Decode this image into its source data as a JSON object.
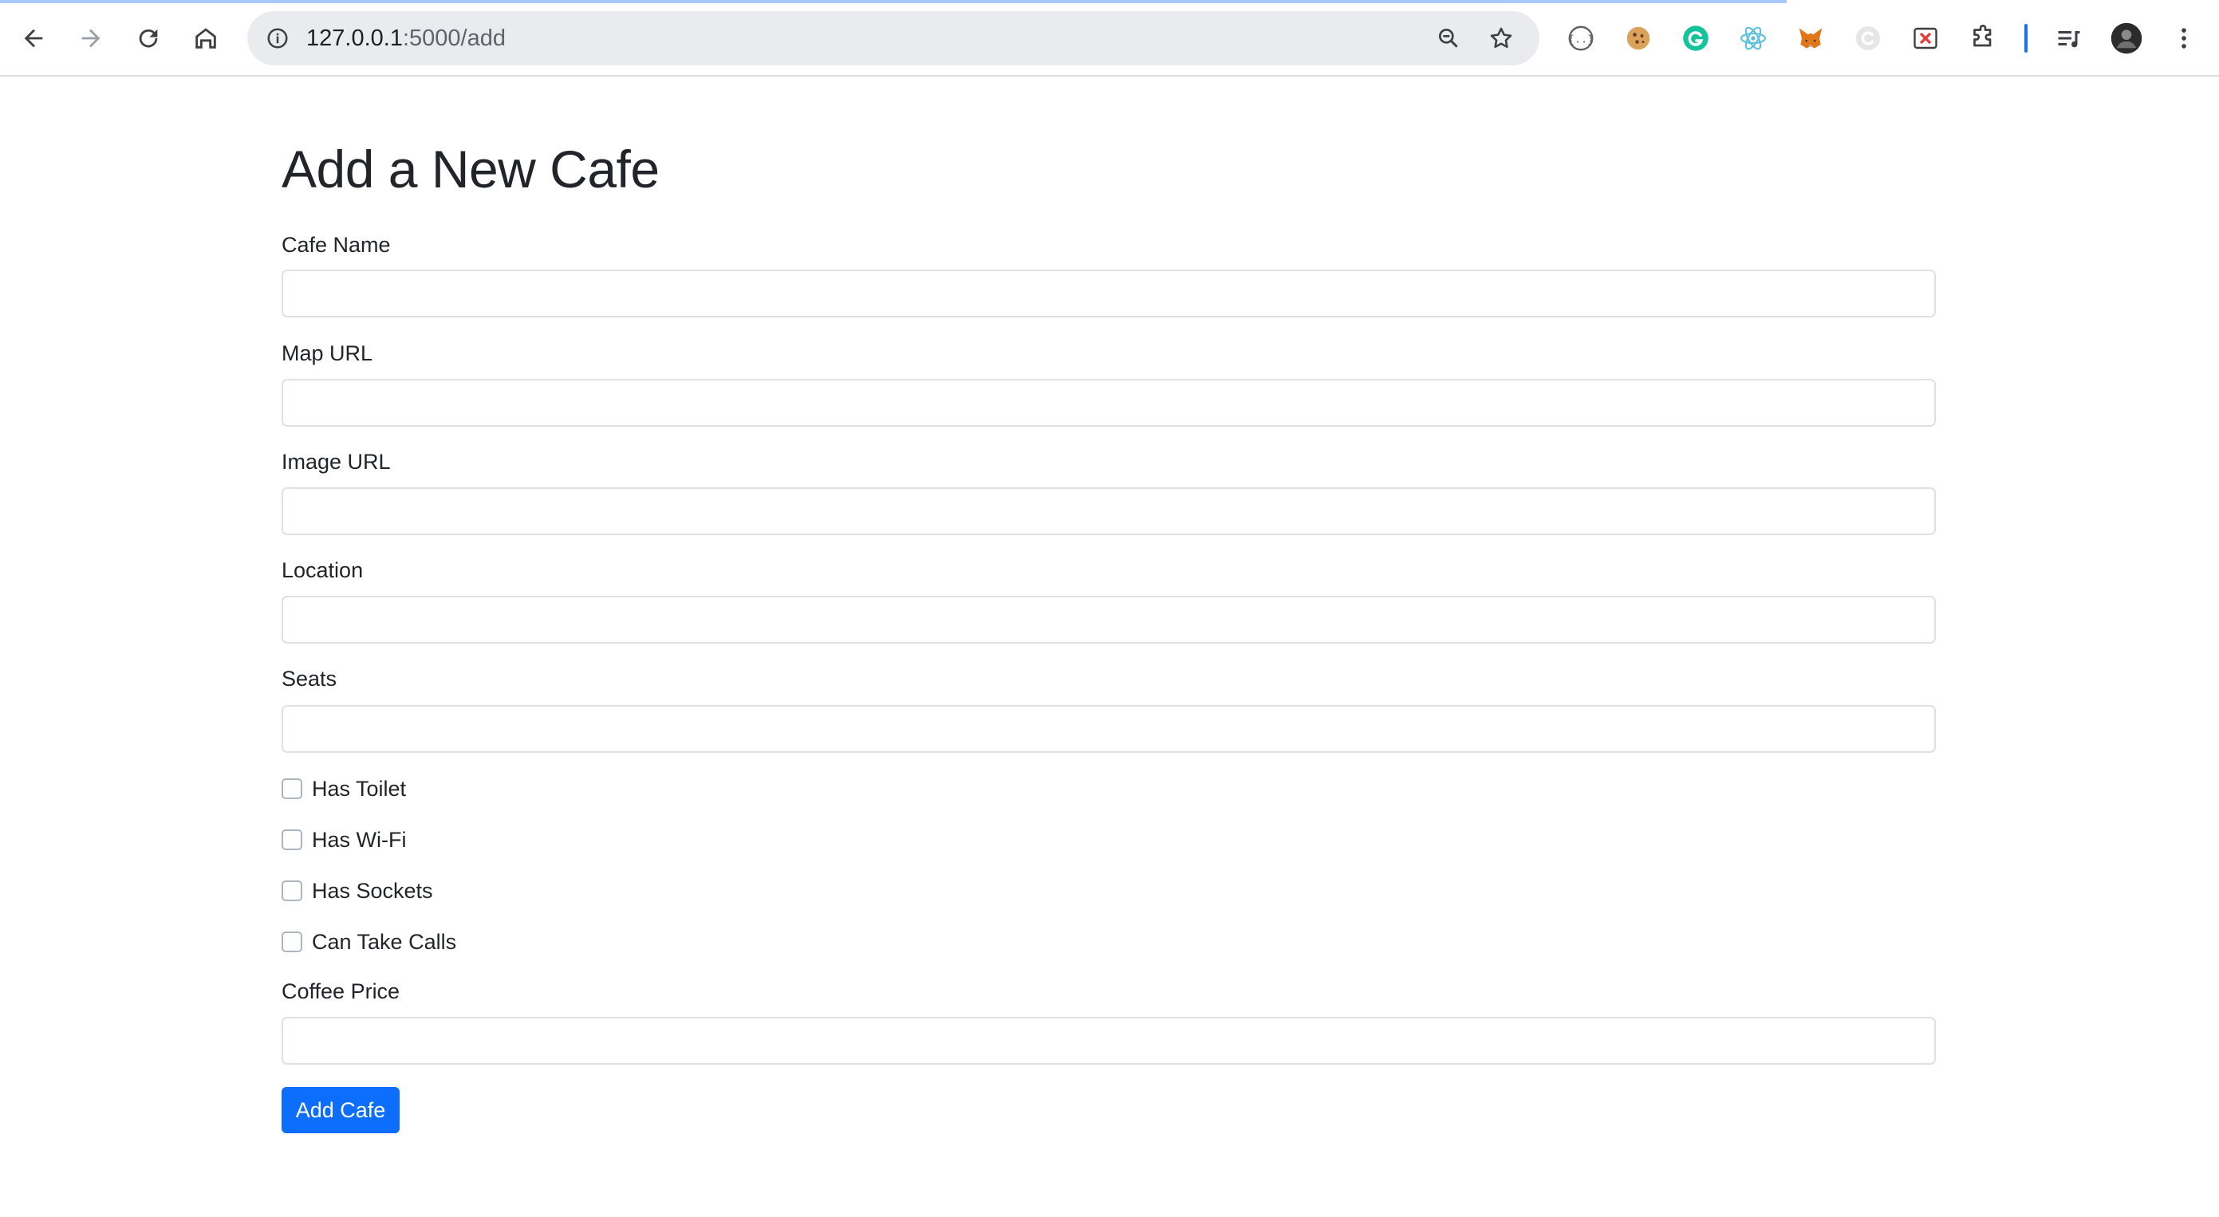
{
  "browser": {
    "url_host": "127.0.0.1",
    "url_path": ":5000/add",
    "nav": {
      "back_icon": "arrow-left-icon",
      "forward_icon": "arrow-right-icon",
      "reload_icon": "reload-icon",
      "home_icon": "home-icon"
    },
    "extensions": [
      "json-viewer-icon",
      "cookie-icon",
      "grammarly-icon",
      "react-devtools-icon",
      "metamask-icon",
      "circle-c-icon",
      "blocked-x-icon",
      "puzzle-icon"
    ],
    "accent_color": "#1a73e8"
  },
  "form": {
    "title": "Add a New Cafe",
    "fields": {
      "cafe_name": {
        "label": "Cafe Name",
        "value": ""
      },
      "map_url": {
        "label": "Map URL",
        "value": ""
      },
      "image_url": {
        "label": "Image URL",
        "value": ""
      },
      "location": {
        "label": "Location",
        "value": ""
      },
      "seats": {
        "label": "Seats",
        "value": ""
      },
      "coffee_price": {
        "label": "Coffee Price",
        "value": ""
      }
    },
    "checkboxes": {
      "has_toilet": {
        "label": "Has Toilet",
        "checked": false
      },
      "has_wifi": {
        "label": "Has Wi-Fi",
        "checked": false
      },
      "has_sockets": {
        "label": "Has Sockets",
        "checked": false
      },
      "can_take_calls": {
        "label": "Can Take Calls",
        "checked": false
      }
    },
    "submit_label": "Add Cafe",
    "primary_color": "#0d6efd"
  }
}
